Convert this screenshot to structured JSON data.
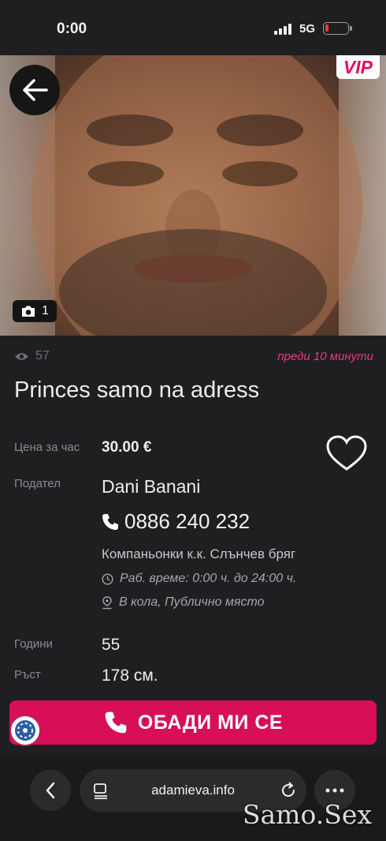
{
  "status_bar": {
    "time": "0:00",
    "network": "5G"
  },
  "listing": {
    "vip_badge": "VIP",
    "photo_count": "1",
    "views": "57",
    "posted": "преди 10 минути",
    "title": "Princes samo na adress",
    "price_label": "Цена за час",
    "price_value": "30.00 €",
    "seller_label": "Подател",
    "seller_name": "Dani Banani",
    "phone": "0886 240 232",
    "category": "Компаньонки к.к. Слънчев бряг",
    "hours": "Раб. време: 0:00 ч. до 24:00 ч.",
    "location": "В кола, Публично място",
    "age_label": "Години",
    "age_value": "55",
    "height_label": "Ръст",
    "height_value": "178 см."
  },
  "call_button": {
    "label": "ОБАДИ МИ СЕ"
  },
  "browser": {
    "url": "adamieva.info"
  },
  "watermark": "Samo.Sex",
  "colors": {
    "accent": "#d80f58",
    "background": "#1f1f22",
    "posted_text": "#e4397f"
  },
  "icons": [
    "back-arrow-icon",
    "camera-icon",
    "eye-icon",
    "heart-icon",
    "phone-icon",
    "clock-icon",
    "location-pin-icon",
    "accessibility-icon",
    "chevron-left-icon",
    "tabs-icon",
    "reload-icon",
    "more-icon"
  ]
}
